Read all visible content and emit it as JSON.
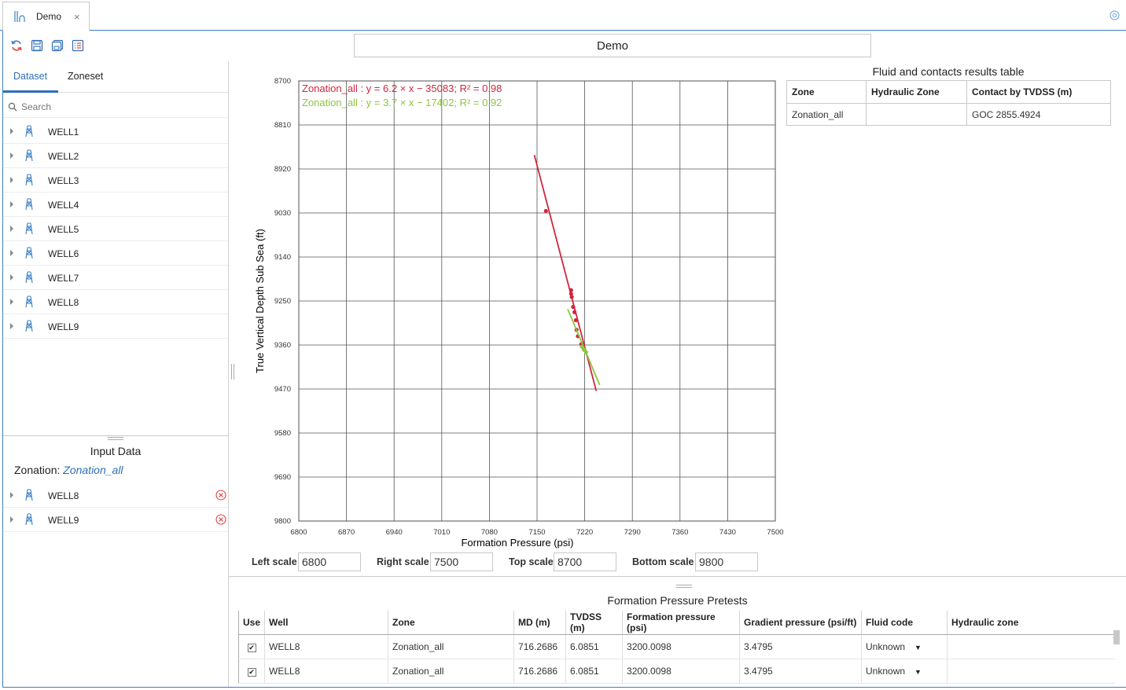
{
  "tab": {
    "title": "Demo",
    "close": "×"
  },
  "page_title": "Demo",
  "left_panel": {
    "tabs": [
      "Dataset",
      "Zoneset"
    ],
    "search_placeholder": "Search",
    "wells": [
      "WELL1",
      "WELL2",
      "WELL3",
      "WELL4",
      "WELL5",
      "WELL6",
      "WELL7",
      "WELL8",
      "WELL9"
    ],
    "input_title": "Input Data",
    "zonation_label": "Zonation:",
    "zonation_value": "Zonation_all",
    "input_wells": [
      "WELL8",
      "WELL9"
    ]
  },
  "chart_data": {
    "type": "scatter",
    "xlabel": "Formation Pressure (psi)",
    "ylabel": "True Vertical Depth Sub Sea (ft)",
    "xlim": [
      6800,
      7500
    ],
    "ylim": [
      8700,
      9800
    ],
    "y_inverted": true,
    "grid": true,
    "x_ticks": [
      "6800",
      "6870",
      "6940",
      "7010",
      "7080",
      "7150",
      "7220",
      "7290",
      "7360",
      "7430",
      "7500"
    ],
    "y_ticks": [
      "8700",
      "8810",
      "8920",
      "9030",
      "9140",
      "9250",
      "9360",
      "9470",
      "9580",
      "9690",
      "9800"
    ],
    "annotations": [
      {
        "text": "Zonation_all : y = 6.2 × x − 35083; R² = 0.98",
        "color": "#d0263e"
      },
      {
        "text": "Zonation_all : y = 3.7 × x − 17402; R² = 0.92",
        "color": "#8cc63e"
      }
    ],
    "series": [
      {
        "color": "#d0263e",
        "line": [
          [
            7146,
            8885
          ],
          [
            7237,
            9475
          ]
        ],
        "points": [
          [
            7163,
            9025
          ],
          [
            7200,
            9223
          ],
          [
            7200,
            9232
          ],
          [
            7201,
            9240
          ],
          [
            7203,
            9265
          ],
          [
            7205,
            9278
          ],
          [
            7207,
            9298
          ],
          [
            7208,
            9322
          ],
          [
            7210,
            9338
          ],
          [
            7215,
            9358
          ],
          [
            7219,
            9370
          ]
        ]
      },
      {
        "color": "#8cc63e",
        "line": [
          [
            7195,
            9270
          ],
          [
            7242,
            9460
          ]
        ],
        "points": [
          [
            7216,
            9364
          ],
          [
            7219,
            9372
          ],
          [
            7222,
            9378
          ]
        ]
      }
    ]
  },
  "scales": {
    "left_label": "Left scale",
    "left_value": "6800",
    "right_label": "Right scale",
    "right_value": "7500",
    "top_label": "Top scale",
    "top_value": "8700",
    "bottom_label": "Bottom scale",
    "bottom_value": "9800"
  },
  "results_table": {
    "title": "Fluid and contacts results table",
    "headers": [
      "Zone",
      "Hydraulic Zone",
      "Contact by TVDSS (m)"
    ],
    "rows": [
      [
        "Zonation_all",
        "",
        "GOC 2855.4924"
      ]
    ]
  },
  "pretests": {
    "title": "Formation Pressure Pretests",
    "headers": [
      "Use",
      "Well",
      "Zone",
      "MD (m)",
      "TVDSS (m)",
      "Formation pressure (psi)",
      "Gradient pressure (psi/ft)",
      "Fluid code",
      "Hydraulic zone"
    ],
    "rows": [
      {
        "use": true,
        "well": "WELL8",
        "zone": "Zonation_all",
        "md": "716.2686",
        "tvdss": "6.0851",
        "fp": "3200.0098",
        "gp": "3.4795",
        "fluid": "Unknown",
        "hz": ""
      },
      {
        "use": true,
        "well": "WELL8",
        "zone": "Zonation_all",
        "md": "716.2686",
        "tvdss": "6.0851",
        "fp": "3200.0098",
        "gp": "3.4795",
        "fluid": "Unknown",
        "hz": ""
      }
    ],
    "check_mark": "✔",
    "select_arrow": "▼"
  },
  "icons": {
    "tab": "well-plot-icon",
    "toolbar": [
      "refresh-icon",
      "save-icon",
      "save-all-icon",
      "list-icon"
    ],
    "corner": "settings-circle-icon",
    "well": "well-derrick-icon",
    "remove": "remove-circle-icon"
  },
  "colors": {
    "accent": "#2f6fb5",
    "frame": "#3c7fc4",
    "series1": "#d0263e",
    "series2": "#8cc63e",
    "remove": "#e0413d"
  }
}
